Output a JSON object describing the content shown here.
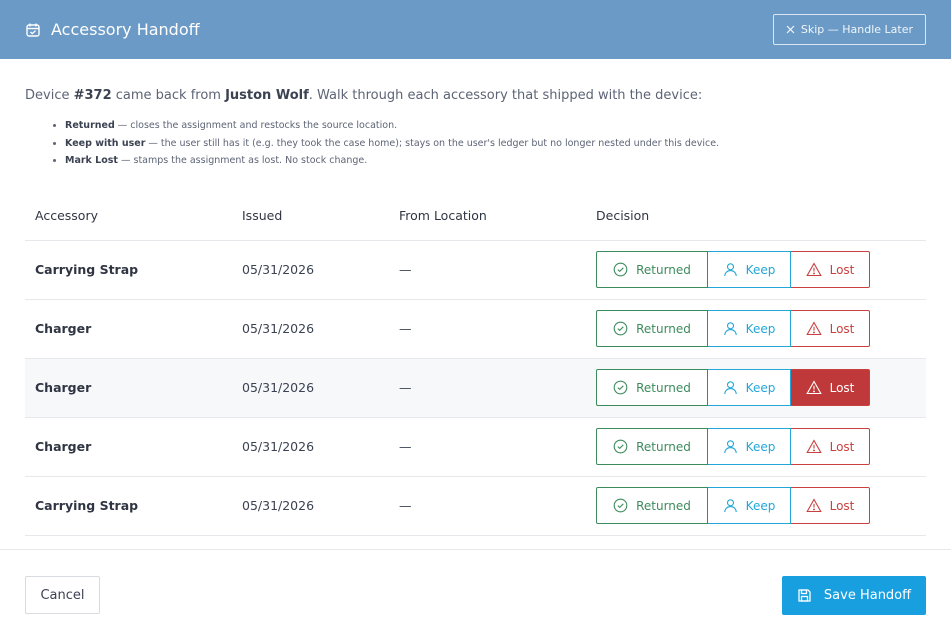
{
  "header": {
    "title": "Accessory Handoff",
    "skip_label": "Skip — Handle Later"
  },
  "intro": {
    "prefix": "Device ",
    "device": "#372",
    "middle": " came back from ",
    "user": "Juston Wolf",
    "suffix": ". Walk through each accessory that shipped with the device:"
  },
  "rules": [
    {
      "term": "Returned",
      "text": " — closes the assignment and restocks the source location."
    },
    {
      "term": "Keep with user",
      "text": " — the user still has it (e.g. they took the case home); stays on the user's ledger but no longer nested under this device."
    },
    {
      "term": "Mark Lost",
      "text": " — stamps the assignment as lost. No stock change."
    }
  ],
  "table": {
    "headers": [
      "Accessory",
      "Issued",
      "From Location",
      "Decision"
    ],
    "rows": [
      {
        "accessory": "Carrying Strap",
        "issued": "05/31/2026",
        "from": "—",
        "decision": "none"
      },
      {
        "accessory": "Charger",
        "issued": "05/31/2026",
        "from": "—",
        "decision": "none"
      },
      {
        "accessory": "Charger",
        "issued": "05/31/2026",
        "from": "—",
        "decision": "lost"
      },
      {
        "accessory": "Charger",
        "issued": "05/31/2026",
        "from": "—",
        "decision": "none"
      },
      {
        "accessory": "Carrying Strap",
        "issued": "05/31/2026",
        "from": "—",
        "decision": "none"
      }
    ]
  },
  "decision_labels": {
    "returned": "Returned",
    "keep": "Keep",
    "lost": "Lost"
  },
  "footer": {
    "cancel_label": "Cancel",
    "save_label": "Save Handoff"
  },
  "colors": {
    "header_bg": "#6b9ac6",
    "returned": "#3d8b5c",
    "keep": "#22a7d6",
    "lost": "#c8403f",
    "save_bg": "#189fe0"
  }
}
